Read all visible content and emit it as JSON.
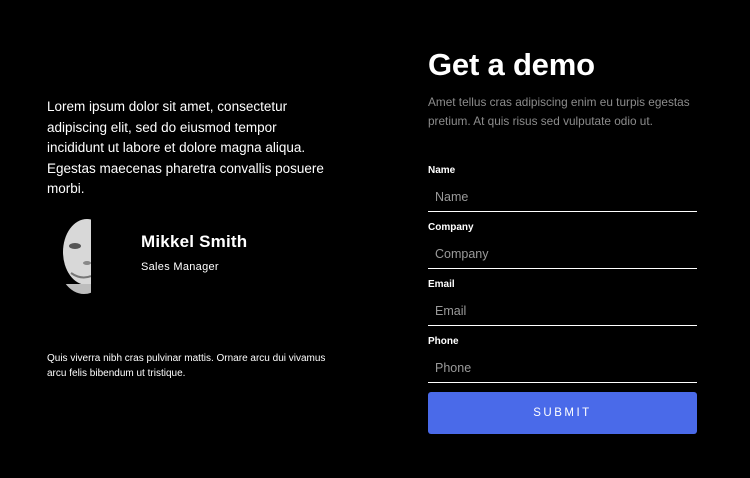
{
  "testimonial": {
    "text": "Lorem ipsum dolor sit amet, consectetur adipiscing elit, sed do eiusmod tempor incididunt ut labore et dolore magna aliqua. Egestas maecenas pharetra convallis posuere morbi.",
    "author_name": "Mikkel Smith",
    "author_role": "Sales Manager",
    "avatar_icon": "person-portrait-icon"
  },
  "footnote": "Quis viverra nibh cras pulvinar mattis. Ornare arcu dui vivamus arcu felis bibendum ut tristique.",
  "form": {
    "title": "Get a demo",
    "description": "Amet tellus cras adipiscing enim eu turpis egestas pretium. At quis risus sed vulputate odio ut.",
    "fields": [
      {
        "label": "Name",
        "placeholder": "Name",
        "value": ""
      },
      {
        "label": "Company",
        "placeholder": "Company",
        "value": ""
      },
      {
        "label": "Email",
        "placeholder": "Email",
        "value": ""
      },
      {
        "label": "Phone",
        "placeholder": "Phone",
        "value": ""
      }
    ],
    "submit_label": "SUBMIT"
  },
  "colors": {
    "background": "#000000",
    "accent": "#4a6ae9",
    "muted_text": "#8c8c8c"
  }
}
